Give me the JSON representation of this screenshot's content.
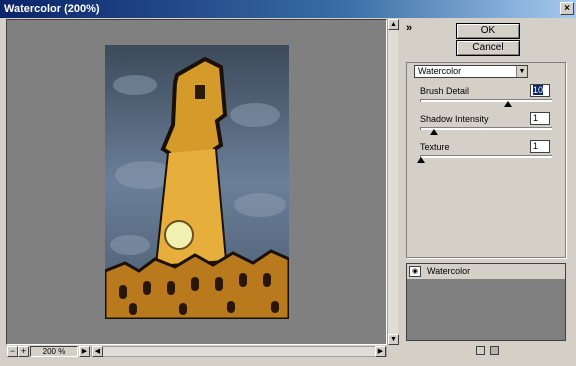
{
  "window": {
    "title": "Watercolor (200%)",
    "close_glyph": "×"
  },
  "buttons": {
    "ok": "OK",
    "cancel": "Cancel"
  },
  "collapse_glyph": "»",
  "filter_select": {
    "value": "Watercolor"
  },
  "params": [
    {
      "label": "Brush Detail",
      "value": "10",
      "fraction": 0.68
    },
    {
      "label": "Shadow Intensity",
      "value": "1",
      "fraction": 0.1
    },
    {
      "label": "Texture",
      "value": "1",
      "fraction": 0.0
    }
  ],
  "zoom": {
    "minus": "−",
    "plus": "+",
    "value": "200 %"
  },
  "layers": [
    {
      "name": "Watercolor"
    }
  ],
  "icons": {
    "close": "close-icon",
    "eye": "eye-icon",
    "new_layer": "new-layer-icon",
    "delete_layer": "trash-icon",
    "scroll_up": "arrow-up-icon",
    "scroll_down": "arrow-down-icon"
  }
}
